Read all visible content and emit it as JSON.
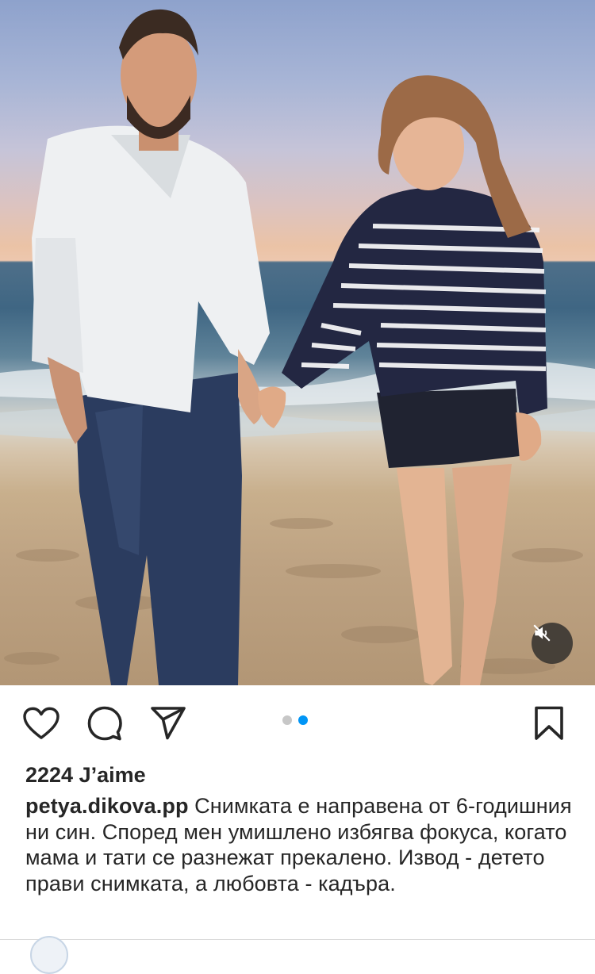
{
  "post": {
    "media": {
      "carousel_count": 2,
      "active_index": 1,
      "sound": "muted"
    },
    "actions": {
      "like_icon": "heart-icon",
      "comment_icon": "comment-icon",
      "share_icon": "paper-plane-icon",
      "save_icon": "bookmark-icon",
      "mute_icon": "speaker-muted-icon"
    },
    "likes_text": "2224 J’aime",
    "caption": {
      "username": "petya.dikova.pp",
      "text": "Снимката е направена от 6-годишния ни син. Според мен умишлено избягва фокуса, когато мама и тати се разнежат прекалено. Извод - детето прави снимката, а любовта - кадъра."
    },
    "colors": {
      "accent": "#0095f6",
      "text": "#262626",
      "inactive_dot": "#c7c7c7"
    }
  }
}
